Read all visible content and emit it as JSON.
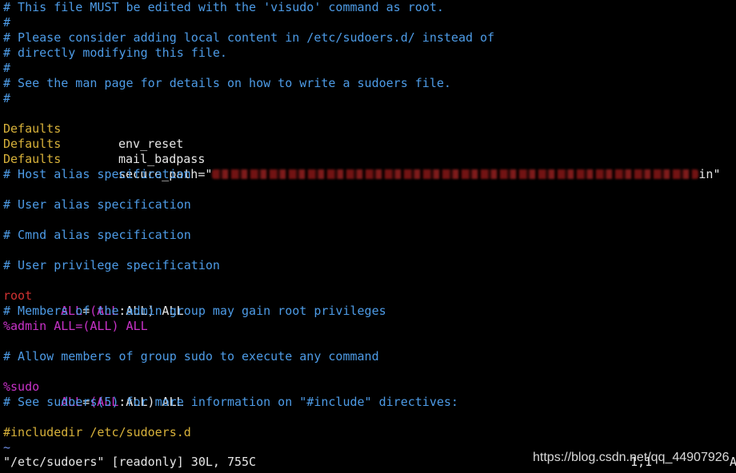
{
  "editor": {
    "lines": {
      "l1": "# This file MUST be edited with the 'visudo' command as root.",
      "l2": "#",
      "l3": "# Please consider adding local content in /etc/sudoers.d/ instead of",
      "l4": "# directly modifying this file.",
      "l5": "#",
      "l6": "# See the man page for details on how to write a sudoers file.",
      "l7": "#",
      "defaults": [
        {
          "key": "Defaults",
          "value": "env_reset"
        },
        {
          "key": "Defaults",
          "value": "mail_badpass"
        },
        {
          "key": "Defaults",
          "value_prefix": "secure_path=\"",
          "value_suffix": "in\""
        }
      ],
      "host_alias": "# Host alias specification",
      "user_alias": "# User alias specification",
      "cmnd_alias": "# Cmnd alias specification",
      "user_priv": "# User privilege specification",
      "root_rule": {
        "user": "root",
        "all1": "ALL",
        "eq": "=",
        "open": "(",
        "all2": "ALL",
        "colon": ":",
        "rest": "ALL) ALL"
      },
      "admin_comment": "# Members of the admin group may gain root privileges",
      "admin_rule": {
        "user": "%admin",
        "rest": "ALL=(ALL) ALL"
      },
      "sudo_comment": "# Allow members of group sudo to execute any command",
      "sudo_rule": {
        "user": "%sudo",
        "all1": "ALL",
        "eq": "=",
        "open": "(",
        "all2": "ALL",
        "colon": ":",
        "rest": "ALL) ALL"
      },
      "include_comment": "# See sudoers(5) for more information on \"#include\" directives:",
      "includedir": "#includedir /etc/sudoers.d",
      "tilde": "~"
    },
    "status": "\"/etc/sudoers\" [readonly] 30L, 755C",
    "ruler": "1,1",
    "ruler_end": "A"
  },
  "watermark": "https://blog.csdn.net/qq_44907926",
  "colors": {
    "background": "#000000",
    "comment": "#4d9be6",
    "keyword": "#d7b13a",
    "text": "#e6e6e6",
    "magenta": "#c832c8",
    "red": "#d23232"
  }
}
